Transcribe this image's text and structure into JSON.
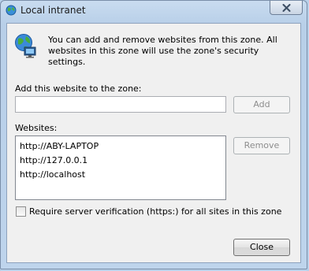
{
  "window": {
    "title": "Local intranet"
  },
  "description": "You can add and remove websites from this zone. All websites in this zone will use the zone's security settings.",
  "add_section": {
    "label": "Add this website to the zone:",
    "input_value": "",
    "add_button": "Add"
  },
  "websites_section": {
    "label": "Websites:",
    "items": [
      "http://ABY-LAPTOP",
      "http://127.0.0.1",
      "http://localhost"
    ],
    "remove_button": "Remove"
  },
  "verification": {
    "label": "Require server verification (https:) for all sites in this zone",
    "checked": false
  },
  "footer": {
    "close_button": "Close"
  },
  "icons": {
    "title": "intranet-globe-icon",
    "zone": "intranet-globe-monitor-icon",
    "close": "close-x-icon"
  }
}
